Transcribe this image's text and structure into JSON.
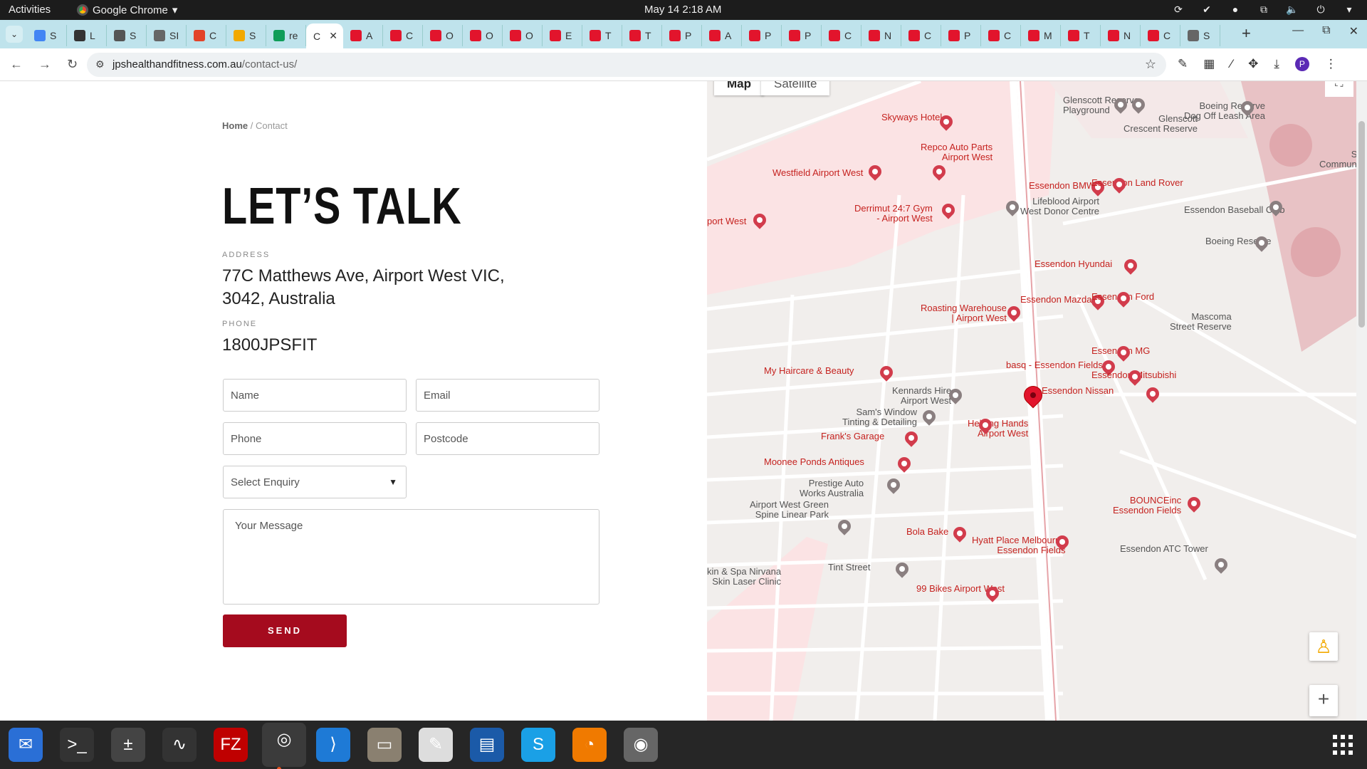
{
  "topbar": {
    "activities": "Activities",
    "app_name": "Google Chrome",
    "clock": "May 14  2:18 AM"
  },
  "browser": {
    "tabs": [
      {
        "label": "S",
        "color": "#4285f4"
      },
      {
        "label": "L",
        "color": "#333333"
      },
      {
        "label": "S",
        "color": "#555555"
      },
      {
        "label": "SI",
        "color": "#666666"
      },
      {
        "label": "C",
        "color": "#e24329"
      },
      {
        "label": "S",
        "color": "#f2a900"
      },
      {
        "label": "re",
        "color": "#0f9d58"
      },
      {
        "label": "C",
        "color": "#ffffff",
        "active": true
      },
      {
        "label": "A",
        "color": "#e2142c"
      },
      {
        "label": "C",
        "color": "#e2142c"
      },
      {
        "label": "O",
        "color": "#e2142c"
      },
      {
        "label": "O",
        "color": "#e2142c"
      },
      {
        "label": "O",
        "color": "#e2142c"
      },
      {
        "label": "E",
        "color": "#e2142c"
      },
      {
        "label": "T",
        "color": "#e2142c"
      },
      {
        "label": "T",
        "color": "#e2142c"
      },
      {
        "label": "P",
        "color": "#e2142c"
      },
      {
        "label": "A",
        "color": "#e2142c"
      },
      {
        "label": "P",
        "color": "#e2142c"
      },
      {
        "label": "P",
        "color": "#e2142c"
      },
      {
        "label": "C",
        "color": "#e2142c"
      },
      {
        "label": "N",
        "color": "#e2142c"
      },
      {
        "label": "C",
        "color": "#e2142c"
      },
      {
        "label": "P",
        "color": "#e2142c"
      },
      {
        "label": "C",
        "color": "#e2142c"
      },
      {
        "label": "M",
        "color": "#e2142c"
      },
      {
        "label": "T",
        "color": "#e2142c"
      },
      {
        "label": "N",
        "color": "#e2142c"
      },
      {
        "label": "C",
        "color": "#e2142c"
      },
      {
        "label": "S",
        "color": "#666666"
      }
    ],
    "url_domain": "jpshealthandfitness.com.au",
    "url_path": "/contact-us/"
  },
  "page": {
    "breadcrumb_home": "Home",
    "breadcrumb_sep": " / ",
    "breadcrumb_current": "Contact",
    "title": "LET’S TALK",
    "address_label": "ADDRESS",
    "address_line1": "77C Matthews Ave, Airport West VIC,",
    "address_line2": "3042, Australia",
    "phone_label": "PHONE",
    "phone_value": "1800JPSFIT",
    "form": {
      "name_placeholder": "Name",
      "email_placeholder": "Email",
      "phone_placeholder": "Phone",
      "postcode_placeholder": "Postcode",
      "enquiry_selected": "Select Enquiry",
      "message_placeholder": "Your Message",
      "send_label": "SEND"
    }
  },
  "map": {
    "type_map": "Map",
    "type_satellite": "Satellite",
    "labels": [
      {
        "text": "Skyways Hotel",
        "kind": "red"
      },
      {
        "text": "Repco Auto Parts\nAirport West",
        "kind": "red"
      },
      {
        "text": "Westfield Airport West",
        "kind": "red"
      },
      {
        "text": "Derrimut 24:7 Gym\n- Airport West",
        "kind": "red"
      },
      {
        "text": "port West",
        "kind": "red"
      },
      {
        "text": "Lifeblood Airport\nWest Donor Centre",
        "kind": "grey"
      },
      {
        "text": "Glenscott Reserve\nPlayground",
        "kind": "grey"
      },
      {
        "text": "Glenscott\nCrescent Reserve",
        "kind": "grey"
      },
      {
        "text": "Boeing Reserve\nDog Off Leash Area",
        "kind": "grey"
      },
      {
        "text": "Essendon BMW",
        "kind": "red"
      },
      {
        "text": "Essendon Land Rover",
        "kind": "red"
      },
      {
        "text": "Strath\nCommunity G",
        "kind": "grey"
      },
      {
        "text": "Essendon Baseball Club",
        "kind": "grey"
      },
      {
        "text": "Boeing Reserve",
        "kind": "grey"
      },
      {
        "text": "Essendon Hyundai",
        "kind": "red"
      },
      {
        "text": "Essendon Mazda",
        "kind": "red"
      },
      {
        "text": "Essendon Ford",
        "kind": "red"
      },
      {
        "text": "Roasting Warehouse\n| Airport West",
        "kind": "red"
      },
      {
        "text": "Mascoma\nStreet Reserve",
        "kind": "grey"
      },
      {
        "text": "Essendon MG",
        "kind": "red"
      },
      {
        "text": "basq - Essendon Fields",
        "kind": "red"
      },
      {
        "text": "Essendon Mitsubishi",
        "kind": "red"
      },
      {
        "text": "My Haircare & Beauty",
        "kind": "red"
      },
      {
        "text": "Essendon Nissan",
        "kind": "red"
      },
      {
        "text": "Kennards Hire\nAirport West",
        "kind": "grey"
      },
      {
        "text": "Sam's Window\nTinting & Detailing",
        "kind": "grey"
      },
      {
        "text": "Helping Hands\nAirport West",
        "kind": "red"
      },
      {
        "text": "Frank's Garage",
        "kind": "red"
      },
      {
        "text": "Moonee Ponds Antiques",
        "kind": "red"
      },
      {
        "text": "Prestige Auto\nWorks Australia",
        "kind": "grey"
      },
      {
        "text": "BOUNCEinc\nEssendon Fields",
        "kind": "red"
      },
      {
        "text": "Airport West Green\nSpine Linear Park",
        "kind": "grey"
      },
      {
        "text": "Bola Bake",
        "kind": "red"
      },
      {
        "text": "Hyatt Place Melbourne\nEssendon Fields",
        "kind": "red"
      },
      {
        "text": "Essendon ATC Tower",
        "kind": "grey"
      },
      {
        "text": "Tint Street",
        "kind": "grey"
      },
      {
        "text": "kin & Spa Nirvana\nSkin Laser Clinic",
        "kind": "grey"
      },
      {
        "text": "99 Bikes Airport West",
        "kind": "red"
      }
    ]
  },
  "dock": {
    "apps": [
      "Thunderbird",
      "Terminal",
      "Calculator",
      "System Monitor",
      "FileZilla",
      "Google Chrome",
      "Visual Studio Code",
      "Files",
      "Text Editor",
      "LibreOffice Writer",
      "Skype",
      "Blender",
      "Disks"
    ]
  },
  "colors": {
    "accent": "#a50b1e",
    "map_poi_red": "#c5221f"
  }
}
